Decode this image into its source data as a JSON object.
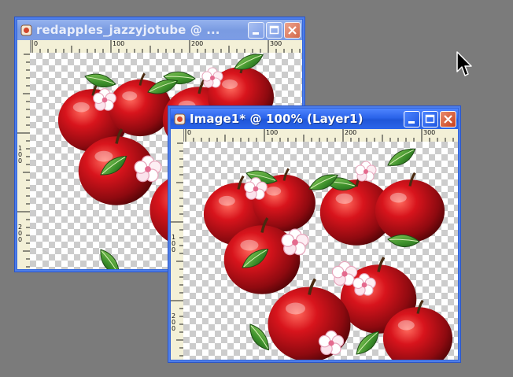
{
  "workspace": {
    "background_color": "#7b7b7b"
  },
  "windows": [
    {
      "title": "redapples_jazzyjotube @ ...",
      "active": false,
      "ruler_top_labels": [
        "0",
        "100",
        "200",
        "300"
      ],
      "ruler_left_labels": [
        "1\n0\n0",
        "2\n0\n0"
      ],
      "buttons": [
        "minimize",
        "maximize",
        "close"
      ]
    },
    {
      "title": "Image1* @ 100% (Layer1)",
      "active": true,
      "ruler_top_labels": [
        "0",
        "100",
        "200",
        "300"
      ],
      "ruler_left_labels": [
        "1\n0\n0",
        "2\n0\n0"
      ],
      "buttons": [
        "minimize",
        "maximize",
        "close"
      ]
    }
  ],
  "icons": {
    "app": "paint-shop-pro-icon",
    "minimize": "minimize-icon",
    "maximize": "maximize-icon",
    "close": "close-icon",
    "cursor": "mouse-pointer-icon"
  },
  "colors": {
    "active_title": "#2a63e9",
    "inactive_title": "#7a9be2",
    "close_button": "#c8401e",
    "ruler": "#f3f0d7",
    "apple_red": "#c0141b",
    "leaf_green": "#3f8f2e",
    "blossom_pink": "#f3c6d6"
  }
}
